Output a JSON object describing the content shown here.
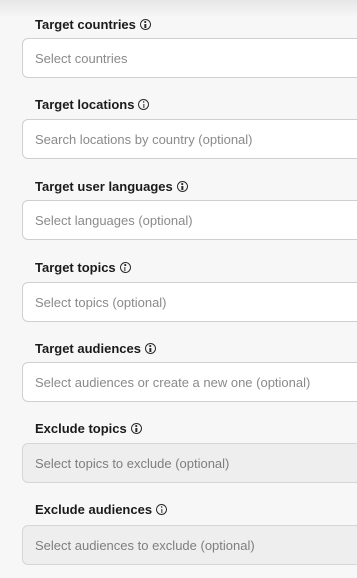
{
  "fields": [
    {
      "label": "Target countries",
      "placeholder": "Select countries",
      "disabled": false
    },
    {
      "label": "Target locations",
      "placeholder": "Search locations by country (optional)",
      "disabled": false
    },
    {
      "label": "Target user languages",
      "placeholder": "Select languages (optional)",
      "disabled": false
    },
    {
      "label": "Target topics",
      "placeholder": "Select topics (optional)",
      "disabled": false
    },
    {
      "label": "Target audiences",
      "placeholder": "Select audiences or create a new one (optional)",
      "disabled": false
    },
    {
      "label": "Exclude topics",
      "placeholder": "Select topics to exclude (optional)",
      "disabled": true
    },
    {
      "label": "Exclude audiences",
      "placeholder": "Select audiences to exclude (optional)",
      "disabled": true
    }
  ],
  "icons": {
    "info": "info-icon"
  }
}
